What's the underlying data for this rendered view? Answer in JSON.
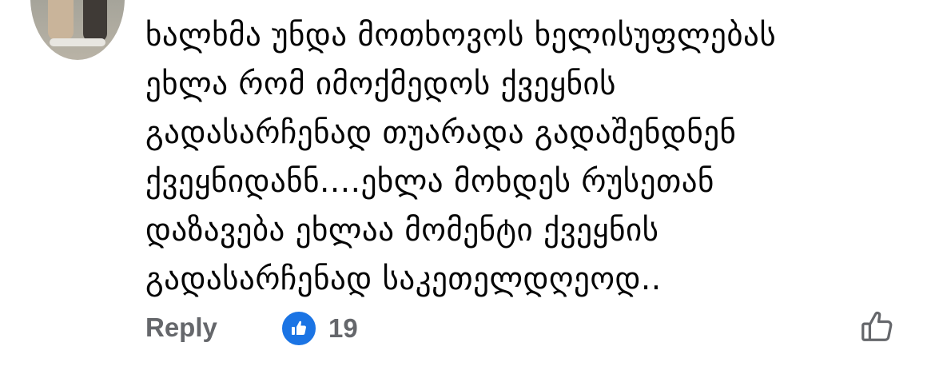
{
  "comment": {
    "lines": [
      "ხალხმა უნდა მოთხოვოს ხელისუფლებას",
      "ეხლა რომ იმოქმედოს ქვეყნის",
      "გადასარჩენად თუარადა გადაშენდნენ",
      "ქვეყნიდანნ....ეხლა მოხდეს რუსეთან",
      "დაზავება ეხლაა მომენტი ქვეყნის",
      "გადასარჩენად საკეთელდღეოდ.."
    ]
  },
  "actions": {
    "reply_label": "Reply",
    "reaction_count": "19"
  },
  "icons": {
    "avatar": "avatar",
    "reaction": "like-reaction-icon",
    "like_button": "thumbs-up-outline-icon"
  },
  "colors": {
    "text": "#050505",
    "secondary_text": "#65676b",
    "like_blue": "#1b74e4"
  }
}
